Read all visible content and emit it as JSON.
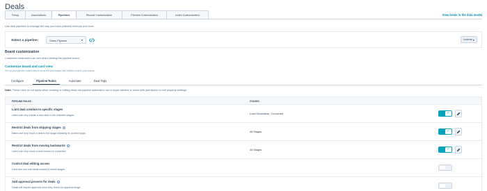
{
  "page": {
    "title": "Deals"
  },
  "tabs": [
    {
      "label": "Setup",
      "width": 30
    },
    {
      "label": "Associations",
      "width": 38
    },
    {
      "label": "Pipelines",
      "width": 35,
      "active": true
    },
    {
      "label": "Record Customization",
      "width": 66
    },
    {
      "label": "Preview Customization",
      "width": 64
    },
    {
      "label": "Index Customization",
      "width": 60
    }
  ],
  "data_model_link": "View Deals in the data model",
  "intro": "Use deal pipelines to manage the way you track potential revenue over time.",
  "pipeline": {
    "label": "Select a pipeline:",
    "selected": "Sales Pipeline",
    "actions_label": "Actions"
  },
  "board": {
    "title": "Board customization",
    "desc": "Customize what users can see when viewing the pipeline board.",
    "link": "Customize board and card view",
    "link_desc": "Set up your pipeline board view to show the information that matters most to your teams."
  },
  "subtabs": [
    "Configure",
    "Pipeline Rules",
    "Automate",
    "Deal Tags"
  ],
  "active_subtab": "Pipeline Rules",
  "note": {
    "prefix": "Note:",
    "text": "These rules do not apply when creating or editing deals via pipeline automation nor to super admins or users with permission to edit property settings."
  },
  "table": {
    "col_rules": "PIPELINE RULES",
    "col_stages": "STAGES",
    "rows": [
      {
        "name": "Limit deal creation to specific stages",
        "info": false,
        "desc": "Users can only create a new deal in the selected stages.",
        "stages": "Lead Generation, Converted",
        "on": true,
        "edit": true
      },
      {
        "name": "Restrict deals from skipping stages",
        "info": true,
        "desc": "Users can only move a deal to the stage following its current stage.",
        "stages": "All Stages",
        "on": true,
        "edit": true
      },
      {
        "name": "Restrict deals from moving backwards",
        "info": true,
        "desc": "Users can only move a deal forward in a pipeline.",
        "stages": "All Stages",
        "on": true,
        "edit": true
      },
      {
        "name": "Control deal editing access",
        "info": false,
        "desc": "Limit who can edit deals moved to select stages.",
        "stages": "",
        "on": false,
        "edit": false
      },
      {
        "name": "Add approval process for deals",
        "info": true,
        "desc": "Deals will require approval once they reach an approval stage.",
        "stages": "",
        "on": false,
        "edit": false
      }
    ]
  },
  "colors": {
    "accent": "#00a4bd",
    "link": "#0091ae",
    "text": "#33475b"
  }
}
